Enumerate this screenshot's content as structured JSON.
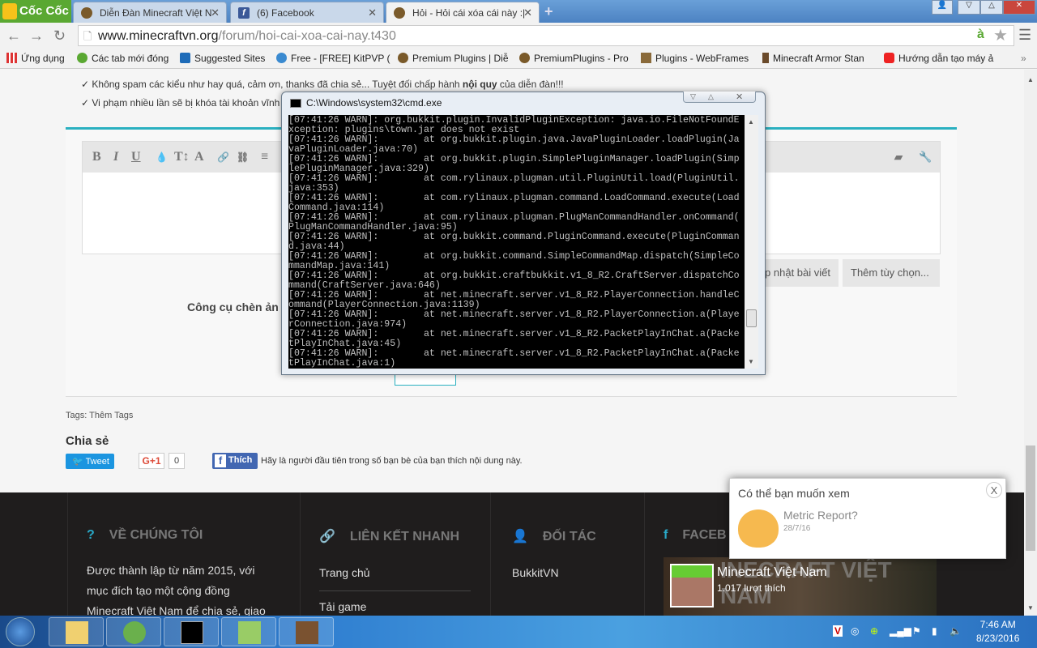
{
  "browser": {
    "brand": "Cốc Cốc",
    "tabs": [
      {
        "title": "Diễn Đàn Minecraft Việt N",
        "icon": "minecraft-favicon"
      },
      {
        "title": "(6) Facebook",
        "icon": "facebook-favicon"
      },
      {
        "title": "Hỏi - Hỏi cái xóa cái này :|",
        "icon": "minecraft-favicon",
        "active": true
      }
    ],
    "url_domain": "www.minecraftvn.org",
    "url_path": "/forum/hoi-cai-xoa-cai-nay.t430",
    "bookmarks": [
      "Ứng dụng",
      "Các tab mới đóng",
      "Suggested Sites",
      "Free - [FREE] KitPVP (",
      "Premium Plugins | Diễ",
      "PremiumPlugins - Pro",
      "Plugins - WebFrames",
      "Minecraft Armor Stan",
      "Hướng dẫn tạo máy ả"
    ],
    "more_bookmarks": "»"
  },
  "page": {
    "rules": [
      "✓ Không spam các kiểu như hay quá, cảm ơn, thanks đã chia sẻ... Tuyệt đối chấp hành ",
      "✓ Vi phạm nhiều lần sẽ bị khóa tài khoản vĩnh"
    ],
    "rules_bold": "nội quy",
    "rules_tail": " của diễn đàn!!!",
    "editor_tools": [
      "B",
      "I",
      "U",
      "💧",
      "T↕",
      "A",
      "🔗",
      "⛓",
      "≡"
    ],
    "update_button": "p nhật bài viết",
    "more_options_button": "Thêm tùy chọn...",
    "image_tool_label": "Công cụ chèn ản",
    "tags_label": "Tags:",
    "tags_link": "Thêm Tags",
    "share_title": "Chia sẻ",
    "tweet": "Tweet",
    "gplus": "G+1",
    "gplus_count": "0",
    "fb_like": "Thích",
    "fb_like_text": "Hãy là người đầu tiên trong số bạn bè của bạn thích nội dung này."
  },
  "footer": {
    "about_title": "VỀ CHÚNG TÔI",
    "about_text": [
      "Được thành lập từ năm 2015, với",
      "mục đích tạo một cộng đồng",
      "Minecraft Việt Nam để chia sẻ, giao"
    ],
    "links_title": "LIÊN KẾT NHANH",
    "links": [
      "Trang chủ",
      "Tải game"
    ],
    "partners_title": "ĐỐI TÁC",
    "partners": [
      "BukkitVN"
    ],
    "facebook_title": "FACEB",
    "fb_page_name": "Minecraft Việt Nam",
    "fb_likes": "1.017 lượt thích",
    "fb_cover_text": "INECRAFT VIỆT NAM"
  },
  "popup": {
    "title": "Có thể bạn muốn xem",
    "close": "X",
    "item_title": "Metric Report?",
    "item_date": "28/7/16"
  },
  "cmd": {
    "title": "C:\\Windows\\system32\\cmd.exe",
    "lines": [
      "[07:41:26 WARN]: org.bukkit.plugin.InvalidPluginException: java.io.FileNotFoundE",
      "xception: plugins\\town.jar does not exist",
      "[07:41:26 WARN]:        at org.bukkit.plugin.java.JavaPluginLoader.loadPlugin(Ja",
      "vaPluginLoader.java:70)",
      "[07:41:26 WARN]:        at org.bukkit.plugin.SimplePluginManager.loadPlugin(Simp",
      "lePluginManager.java:329)",
      "[07:41:26 WARN]:        at com.rylinaux.plugman.util.PluginUtil.load(PluginUtil.",
      "java:353)",
      "[07:41:26 WARN]:        at com.rylinaux.plugman.command.LoadCommand.execute(Load",
      "Command.java:114)",
      "[07:41:26 WARN]:        at com.rylinaux.plugman.PlugManCommandHandler.onCommand(",
      "PlugManCommandHandler.java:95)",
      "[07:41:26 WARN]:        at org.bukkit.command.PluginCommand.execute(PluginComman",
      "d.java:44)",
      "[07:41:26 WARN]:        at org.bukkit.command.SimpleCommandMap.dispatch(SimpleCo",
      "mmandMap.java:141)",
      "[07:41:26 WARN]:        at org.bukkit.craftbukkit.v1_8_R2.CraftServer.dispatchCo",
      "mmand(CraftServer.java:646)",
      "[07:41:26 WARN]:        at net.minecraft.server.v1_8_R2.PlayerConnection.handleC",
      "ommand(PlayerConnection.java:1139)",
      "[07:41:26 WARN]:        at net.minecraft.server.v1_8_R2.PlayerConnection.a(Playe",
      "rConnection.java:974)",
      "[07:41:26 WARN]:        at net.minecraft.server.v1_8_R2.PacketPlayInChat.a(Packe",
      "tPlayInChat.java:45)",
      "[07:41:26 WARN]:        at net.minecraft.server.v1_8_R2.PacketPlayInChat.a(Packe",
      "tPlayInChat.java:1)"
    ]
  },
  "taskbar": {
    "apps": [
      "explorer-icon",
      "coccoc-icon",
      "cmd-icon",
      "notepadpp-icon",
      "minecraft-icon"
    ],
    "time": "7:46 AM",
    "date": "8/23/2016"
  },
  "colors": {
    "accent": "#2ab0c0",
    "footer_bg": "#1f1d1d",
    "coccoc_green": "#5aa832"
  }
}
